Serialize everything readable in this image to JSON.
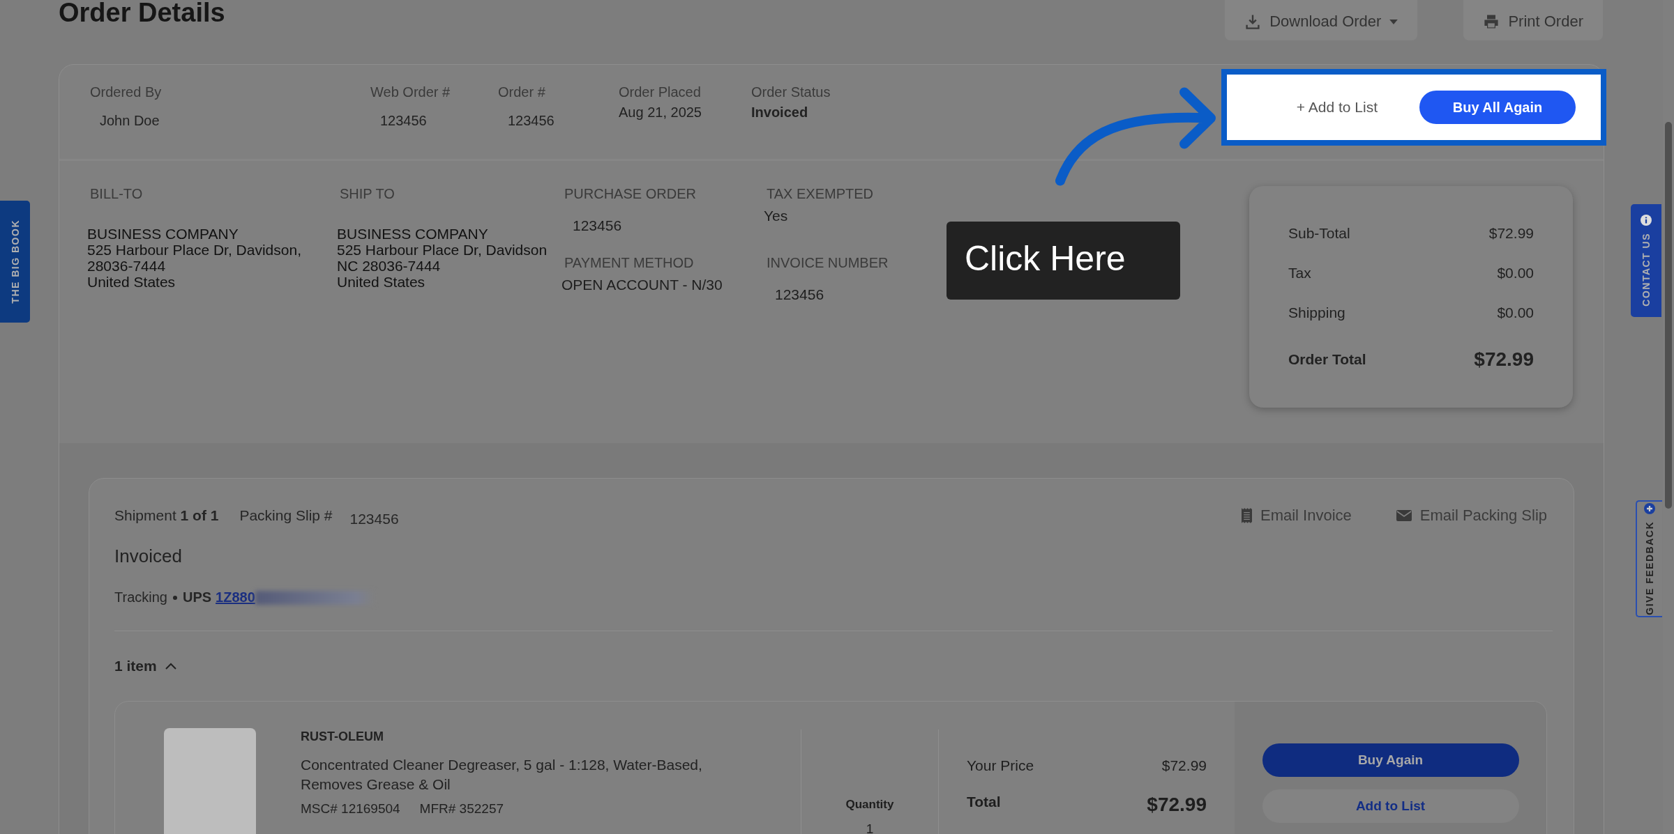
{
  "page_title": "Order Details",
  "header_actions": [
    {
      "kind": "download",
      "label": "Download Order"
    },
    {
      "kind": "print",
      "label": "Print Order"
    }
  ],
  "order_info": [
    {
      "label": "Ordered By",
      "value": "John Doe",
      "bold": false
    },
    {
      "label": "Web Order #",
      "value": "123456",
      "bold": false
    },
    {
      "label": "Order #",
      "value": "123456",
      "bold": false
    },
    {
      "label": "Order Placed",
      "value": "Aug 21, 2025",
      "bold": false
    },
    {
      "label": "Order Status",
      "value": "Invoiced",
      "bold": true
    }
  ],
  "highlighted_actions": {
    "add_to_list": "+ Add to List",
    "buy_all_again": "Buy All Again"
  },
  "callout": {
    "text": "Click Here"
  },
  "addresses": [
    {
      "label": "BILL-TO",
      "lines": [
        "BUSINESS COMPANY",
        "525 Harbour Place Dr, Davidson,",
        "28036-7444",
        "United States"
      ]
    },
    {
      "label": "SHIP TO",
      "lines": [
        "BUSINESS COMPANY",
        "525 Harbour Place Dr, Davidson",
        "NC 28036-7444",
        "United States"
      ]
    }
  ],
  "details": [
    {
      "label": "PURCHASE ORDER",
      "value": "123456"
    },
    {
      "label": "TAX EXEMPTED",
      "value": "Yes"
    },
    {
      "label": "PAYMENT METHOD",
      "value": "OPEN ACCOUNT - N/30"
    },
    {
      "label": "INVOICE NUMBER",
      "value": "123456"
    }
  ],
  "summary": {
    "rows": [
      {
        "label": "Sub-Total",
        "value": "$72.99"
      },
      {
        "label": "Tax",
        "value": "$0.00"
      },
      {
        "label": "Shipping",
        "value": "$0.00"
      }
    ],
    "total_label": "Order Total",
    "total_value": "$72.99"
  },
  "shipment": {
    "title": "Shipment **1 of 1**",
    "packing_slip_label": "Packing Slip #",
    "packing_slip": "123456",
    "actions": [
      {
        "kind": "invoice",
        "label": "Email Invoice"
      },
      {
        "kind": "mail",
        "label": "Email Packing Slip"
      }
    ],
    "status": "Invoiced",
    "tracking_label": "Tracking",
    "carrier": "UPS",
    "tracking_number": "1Z880",
    "items_toggle": {
      "label": "1 item",
      "expanded": true
    },
    "item": {
      "brand": "RUST-OLEUM",
      "description": "Concentrated Cleaner Degreaser, 5 gal - 1:128, Water-Based, Removes Grease & Oil",
      "msc": "MSC# 12169504",
      "mfr": "MFR# 352257",
      "quantity_label": "Quantity",
      "quantity": "1",
      "price_label": "Your Price",
      "price": "$72.99",
      "total_label": "Total",
      "total": "$72.99",
      "buy_again": "Buy Again",
      "add_to_list": "Add to List"
    }
  },
  "side_tabs": [
    {
      "kind": "left",
      "label": "THE BIG BOOK"
    },
    {
      "kind": "contact",
      "label": "CONTACT US"
    },
    {
      "kind": "feedback",
      "label": "GIVE FEEDBACK"
    }
  ]
}
